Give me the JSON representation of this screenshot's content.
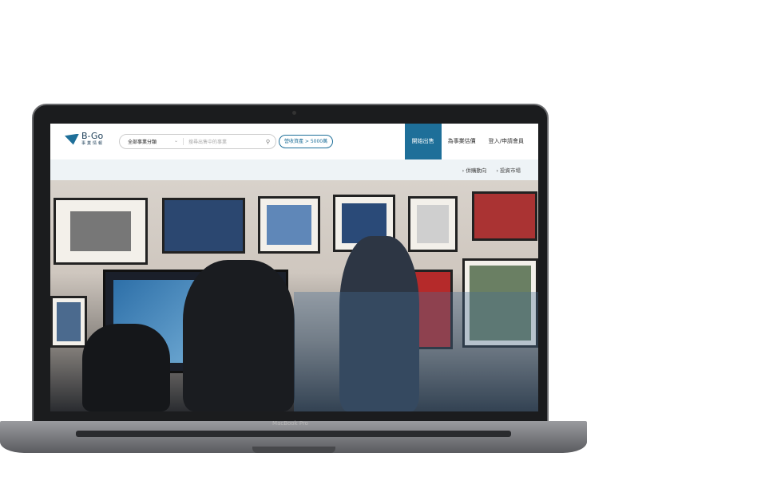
{
  "device": {
    "label": "MacBook Pro"
  },
  "header": {
    "logo": {
      "name": "B-Go",
      "subtitle": "事業情報"
    },
    "search": {
      "category": "全部事業分類",
      "placeholder": "搜尋出售中的事業"
    },
    "filter_pill": "營收資產 > 5000萬",
    "nav": [
      {
        "label": "開始出售",
        "active": true
      },
      {
        "label": "為事業估價"
      },
      {
        "label": "登入/申請會員"
      }
    ]
  },
  "subnav": [
    {
      "label": "併購動向"
    },
    {
      "label": "投資市場"
    }
  ],
  "colors": {
    "accent": "#1e6f99",
    "subnav_bg": "#eef3f6"
  }
}
